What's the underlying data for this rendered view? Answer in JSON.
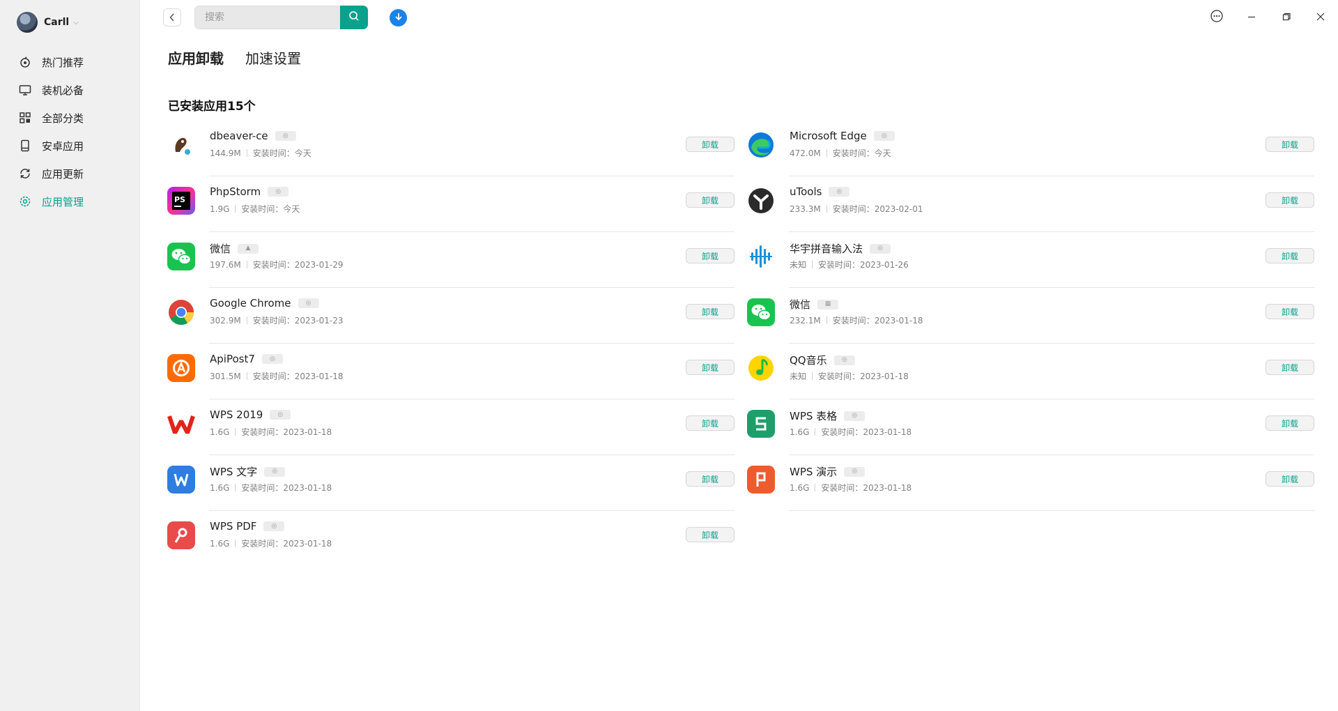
{
  "user": {
    "name": "Carll"
  },
  "search": {
    "placeholder": "搜索"
  },
  "sidebar": {
    "items": [
      {
        "label": "热门推荐",
        "icon": "hot-icon",
        "active": false
      },
      {
        "label": "装机必备",
        "icon": "monitor-icon",
        "active": false
      },
      {
        "label": "全部分类",
        "icon": "category-grid-icon",
        "active": false
      },
      {
        "label": "安卓应用",
        "icon": "phone-icon",
        "active": false
      },
      {
        "label": "应用更新",
        "icon": "refresh-icon",
        "active": false
      },
      {
        "label": "应用管理",
        "icon": "gear-icon",
        "active": true
      }
    ]
  },
  "tabs": [
    {
      "label": "应用卸载",
      "active": true
    },
    {
      "label": "加速设置",
      "active": false
    }
  ],
  "section_title": "已安装应用15个",
  "uninstall_label": "卸载",
  "apps": [
    {
      "name": "dbeaver-ce",
      "size": "144.9M",
      "install_time": "安装时间：今天",
      "icon": "dbeaver-icon",
      "badge": "linux"
    },
    {
      "name": "Microsoft Edge",
      "size": "472.0M",
      "install_time": "安装时间：今天",
      "icon": "edge-icon",
      "badge": "linux"
    },
    {
      "name": "PhpStorm",
      "size": "1.9G",
      "install_time": "安装时间：今天",
      "icon": "phpstorm-icon",
      "badge": "linux"
    },
    {
      "name": "uTools",
      "size": "233.3M",
      "install_time": "安装时间：2023-02-01",
      "icon": "utools-icon",
      "badge": "linux"
    },
    {
      "name": "微信",
      "size": "197.6M",
      "install_time": "安装时间：2023-01-29",
      "icon": "wechat-icon",
      "badge": "android"
    },
    {
      "name": "华宇拼音输入法",
      "size": "未知",
      "install_time": "安装时间：2023-01-26",
      "icon": "huayu-pinyin-icon",
      "badge": "linux"
    },
    {
      "name": "Google Chrome",
      "size": "302.9M",
      "install_time": "安装时间：2023-01-23",
      "icon": "chrome-icon",
      "badge": "linux"
    },
    {
      "name": "微信",
      "size": "232.1M",
      "install_time": "安装时间：2023-01-18",
      "icon": "wechat-icon",
      "badge": "windows"
    },
    {
      "name": "ApiPost7",
      "size": "301.5M",
      "install_time": "安装时间：2023-01-18",
      "icon": "apipost-icon",
      "badge": "linux"
    },
    {
      "name": "QQ音乐",
      "size": "未知",
      "install_time": "安装时间：2023-01-18",
      "icon": "qqmusic-icon",
      "badge": "linux"
    },
    {
      "name": "WPS 2019",
      "size": "1.6G",
      "install_time": "安装时间：2023-01-18",
      "icon": "wps-icon",
      "badge": "linux"
    },
    {
      "name": "WPS 表格",
      "size": "1.6G",
      "install_time": "安装时间：2023-01-18",
      "icon": "wps-sheet-icon",
      "badge": "linux"
    },
    {
      "name": "WPS 文字",
      "size": "1.6G",
      "install_time": "安装时间：2023-01-18",
      "icon": "wps-writer-icon",
      "badge": "linux"
    },
    {
      "name": "WPS 演示",
      "size": "1.6G",
      "install_time": "安装时间：2023-01-18",
      "icon": "wps-presentation-icon",
      "badge": "linux"
    },
    {
      "name": "WPS PDF",
      "size": "1.6G",
      "install_time": "安装时间：2023-01-18",
      "icon": "wps-pdf-icon",
      "badge": "linux"
    }
  ],
  "colors": {
    "accent": "#0aa28c",
    "download": "#1b82e6"
  }
}
